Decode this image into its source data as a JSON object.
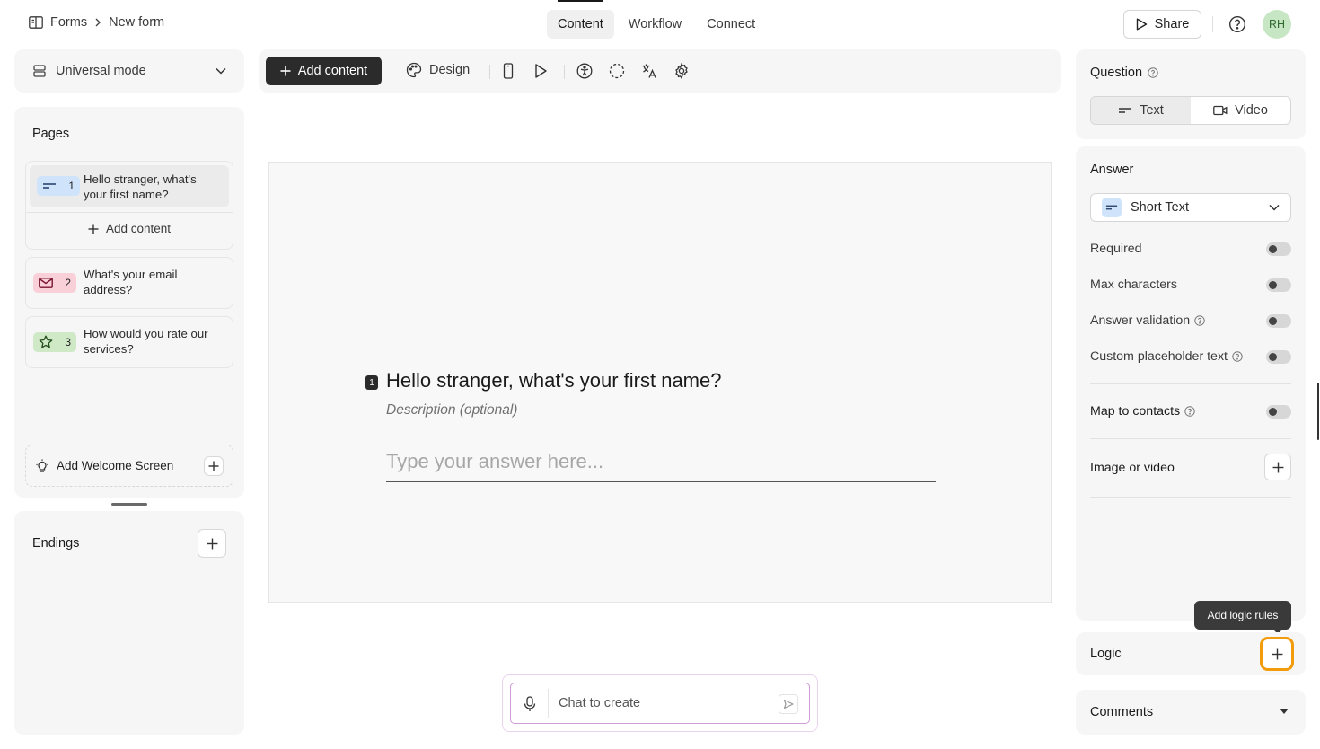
{
  "breadcrumb": {
    "root": "Forms",
    "current": "New form"
  },
  "tabs": [
    {
      "label": "Content",
      "active": true
    },
    {
      "label": "Workflow",
      "active": false
    },
    {
      "label": "Connect",
      "active": false
    }
  ],
  "header": {
    "share_label": "Share",
    "avatar_initials": "RH"
  },
  "left": {
    "mode_label": "Universal mode",
    "pages_title": "Pages",
    "pages": [
      {
        "number": "1",
        "text": "Hello stranger, what's your first name?",
        "icon": "short-text-icon",
        "color": "#cfe4fb"
      },
      {
        "number": "2",
        "text": "What's your email address?",
        "icon": "mail-icon",
        "color": "#f9cfd8"
      },
      {
        "number": "3",
        "text": "How would you rate our services?",
        "icon": "star-icon",
        "color": "#cfe9c6"
      }
    ],
    "add_content_label": "Add content",
    "welcome_label": "Add Welcome Screen",
    "endings_title": "Endings"
  },
  "toolbar": {
    "add_content_label": "Add content",
    "design_label": "Design"
  },
  "canvas": {
    "question_number": "1",
    "question_title": "Hello stranger, what's your first name?",
    "description_placeholder": "Description (optional)",
    "answer_placeholder": "Type your answer here..."
  },
  "chat": {
    "placeholder": "Chat to create"
  },
  "right": {
    "question_title": "Question",
    "question_types": [
      {
        "label": "Text",
        "active": true
      },
      {
        "label": "Video",
        "active": false
      }
    ],
    "answer_title": "Answer",
    "answer_type": "Short Text",
    "options": [
      {
        "label": "Required",
        "help": false,
        "on": false
      },
      {
        "label": "Max characters",
        "help": false,
        "on": false
      },
      {
        "label": "Answer validation",
        "help": true,
        "on": false
      },
      {
        "label": "Custom placeholder text",
        "help": true,
        "on": false
      }
    ],
    "map_contacts_label": "Map to contacts",
    "image_video_label": "Image or video",
    "tooltip": "Add logic rules",
    "logic_title": "Logic",
    "comments_title": "Comments"
  },
  "colors": {
    "accent_highlight": "#f29b0c",
    "primary_button": "#2b2b2b",
    "avatar_bg": "#c7e7c4"
  }
}
